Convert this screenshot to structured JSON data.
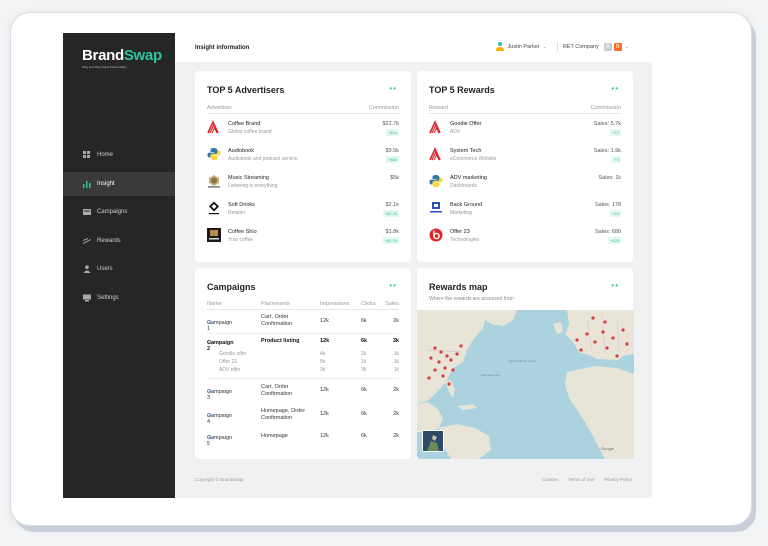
{
  "brand": {
    "name_a": "Brand",
    "name_b": "Swap",
    "tagline": "Plug and Play brand Partnerships"
  },
  "nav": [
    {
      "label": "Home",
      "icon": "home-icon"
    },
    {
      "label": "Insight",
      "icon": "chart-icon",
      "active": true
    },
    {
      "label": "Campaigns",
      "icon": "folder-icon"
    },
    {
      "label": "Rewards",
      "icon": "rewards-icon"
    },
    {
      "label": "Users",
      "icon": "user-icon"
    },
    {
      "label": "Settings",
      "icon": "settings-icon"
    }
  ],
  "header": {
    "title": "Insight information",
    "user": "Justin Parker",
    "company": "RET Company",
    "badge_a": "A",
    "badge_b": "B"
  },
  "advertisers": {
    "title": "TOP 5 Advertisers",
    "col_left": "Advertiser",
    "col_right": "Commission",
    "rows": [
      {
        "name": "Coffee Brand",
        "desc": "Global coffee brand",
        "value": "$22.7k",
        "change": "+$1k"
      },
      {
        "name": "Audiobook",
        "desc": "Audiobook and podcast service",
        "value": "$9.5k",
        "change": "+$6k"
      },
      {
        "name": "Music Streaming",
        "desc": "Listening is everything",
        "value": "$5k",
        "change": ""
      },
      {
        "name": "Soft Drinks",
        "desc": "Retailer",
        "value": "$2.1k",
        "change": "+$2.2k"
      },
      {
        "name": "Coffee Shio",
        "desc": "Your coffee",
        "value": "$1.8k",
        "change": "+$1.2k"
      }
    ]
  },
  "rewards": {
    "title": "TOP 5 Rewards",
    "col_left": "Reward",
    "col_right": "Commission",
    "rows": [
      {
        "name": "Goodie Offer",
        "desc": "ADV",
        "value": "Sales: 5.7k",
        "change": "+12"
      },
      {
        "name": "System Tech",
        "desc": "eCommerce Website",
        "value": "Sales: 1.9k",
        "change": "+4"
      },
      {
        "name": "ADV marketing",
        "desc": "Dashboards",
        "value": "Sales: 1k",
        "change": ""
      },
      {
        "name": "Back Ground",
        "desc": "Marketing",
        "value": "Sales: 178",
        "change": "+15"
      },
      {
        "name": "Offer 23",
        "desc": "Technologies",
        "value": "Sales: 680",
        "change": "+125"
      }
    ]
  },
  "campaigns": {
    "title": "Campaigns",
    "cols": {
      "name": "Name",
      "placements": "Placements",
      "impressions": "Impressions",
      "clicks": "Clicks",
      "sales": "Sales"
    },
    "rows": [
      {
        "name": "Campaign 1",
        "placements": "Cart, Order Confirmation",
        "impressions": "12k",
        "clicks": "6k",
        "sales": "2k"
      },
      {
        "name": "Campaign 2",
        "placements": "Product listing",
        "impressions": "12k",
        "clicks": "6k",
        "sales": "3k",
        "sub": [
          {
            "name": "Goodie offer",
            "impressions": "4k",
            "clicks": "2k",
            "sales": "1k"
          },
          {
            "name": "Offer 23",
            "impressions": "5k",
            "clicks": "1k",
            "sales": "1k"
          },
          {
            "name": "ADV offer",
            "impressions": "3k",
            "clicks": "3k",
            "sales": "1k"
          }
        ]
      },
      {
        "name": "Campaign 3",
        "placements": "Cart, Order Confirmation",
        "impressions": "12k",
        "clicks": "6k",
        "sales": "2k"
      },
      {
        "name": "Campaign 4",
        "placements": "Homepage, Order Confirmation",
        "impressions": "12k",
        "clicks": "6k",
        "sales": "2k"
      },
      {
        "name": "Campaign 5",
        "placements": "Homepage",
        "impressions": "12k",
        "clicks": "6k",
        "sales": "2k"
      }
    ]
  },
  "map": {
    "title": "Rewards map",
    "subtitle": "Where the rewards are accessed from",
    "labels": [
      "North Atlantic Ocean",
      "Sargasso Sea",
      "Google"
    ]
  },
  "footer": {
    "copyright": "Copyright © BrandSwap",
    "links": [
      "Cookies",
      "Terms of use",
      "Privacy Policy"
    ]
  },
  "colors": {
    "accent": "#2ec4a2",
    "sidebar": "#262626",
    "background": "#f0f1f3"
  }
}
